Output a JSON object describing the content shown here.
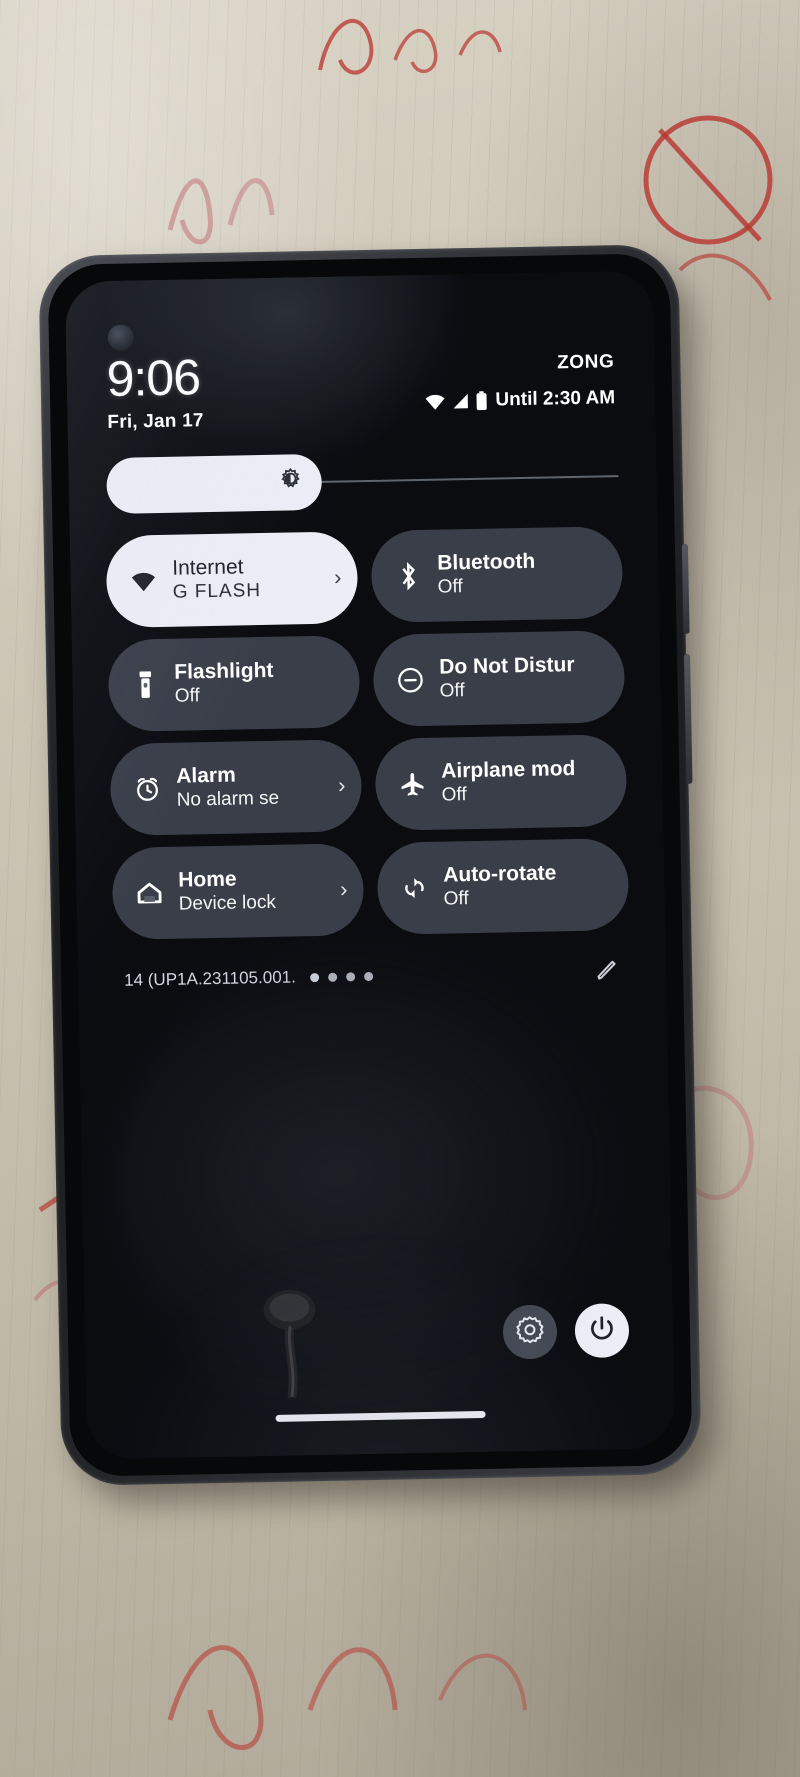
{
  "status": {
    "clock": "9:06",
    "date": "Fri, Jan 17",
    "carrier": "ZONG",
    "battery_text": "Until 2:30 AM",
    "wifi_icon": "wifi-icon",
    "signal_icon": "cellular-signal-icon",
    "battery_icon": "battery-icon"
  },
  "brightness": {
    "icon": "brightness-icon",
    "level_percent": 42
  },
  "tiles": [
    {
      "title": "Internet",
      "subtitle": "G        FLASH",
      "icon": "wifi-icon",
      "active": true,
      "chevron": "›"
    },
    {
      "title": "Bluetooth",
      "subtitle": "Off",
      "icon": "bluetooth-icon",
      "active": false,
      "chevron": ""
    },
    {
      "title": "Flashlight",
      "subtitle": "Off",
      "icon": "flashlight-icon",
      "active": false,
      "chevron": ""
    },
    {
      "title": "Do Not Distur",
      "subtitle": "Off",
      "icon": "do-not-disturb-icon",
      "active": false,
      "chevron": ""
    },
    {
      "title": "Alarm",
      "subtitle": "No alarm se",
      "icon": "alarm-clock-icon",
      "active": false,
      "chevron": "›"
    },
    {
      "title": "Airplane mod",
      "subtitle": "Off",
      "icon": "airplane-icon",
      "active": false,
      "chevron": ""
    },
    {
      "title": "Home",
      "subtitle": "Device lock",
      "icon": "home-icon",
      "active": false,
      "chevron": "›"
    },
    {
      "title": "Auto-rotate",
      "subtitle": "Off",
      "icon": "auto-rotate-icon",
      "active": false,
      "chevron": ""
    }
  ],
  "footer": {
    "build": "14 (UP1A.231105.001.",
    "page_dots": 4,
    "active_dot_index": 0,
    "edit_icon": "pencil-edit-icon"
  },
  "bottom_controls": {
    "settings_icon": "gear-icon",
    "power_icon": "power-icon"
  },
  "colors": {
    "tile_active_bg": "#eceef6",
    "tile_inactive_bg": "#585e6c",
    "screen_bg": "#0a0c10",
    "text_primary": "#ffffff"
  }
}
